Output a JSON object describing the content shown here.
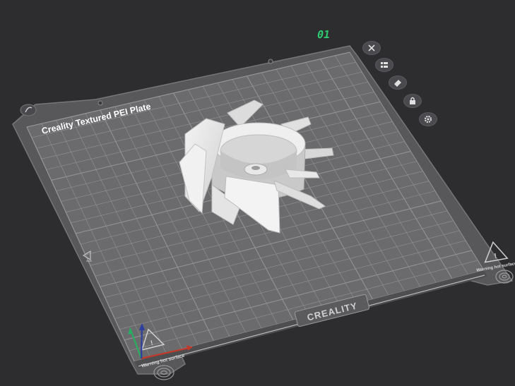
{
  "plate": {
    "title": "Creality Textured PEI Plate",
    "number": "01",
    "brand": "CREALITY",
    "warning_left": "Warning hot surface",
    "warning_right": "Warning hot surface"
  },
  "plate_controls": [
    {
      "name": "close",
      "icon": "close-icon"
    },
    {
      "name": "arrange",
      "icon": "list-icon"
    },
    {
      "name": "orient",
      "icon": "eraser-icon"
    },
    {
      "name": "lock",
      "icon": "lock-icon"
    },
    {
      "name": "settings",
      "icon": "gear-icon"
    }
  ],
  "colors": {
    "background": "#2d2d2f",
    "plate": "#6b6b6e",
    "grid": "#9a9a9d",
    "model": "#e8e8e8",
    "plate_number": "#2ecc71",
    "axis_x": "#c0392b",
    "axis_y": "#27ae60",
    "axis_z": "#2c3e9e"
  }
}
